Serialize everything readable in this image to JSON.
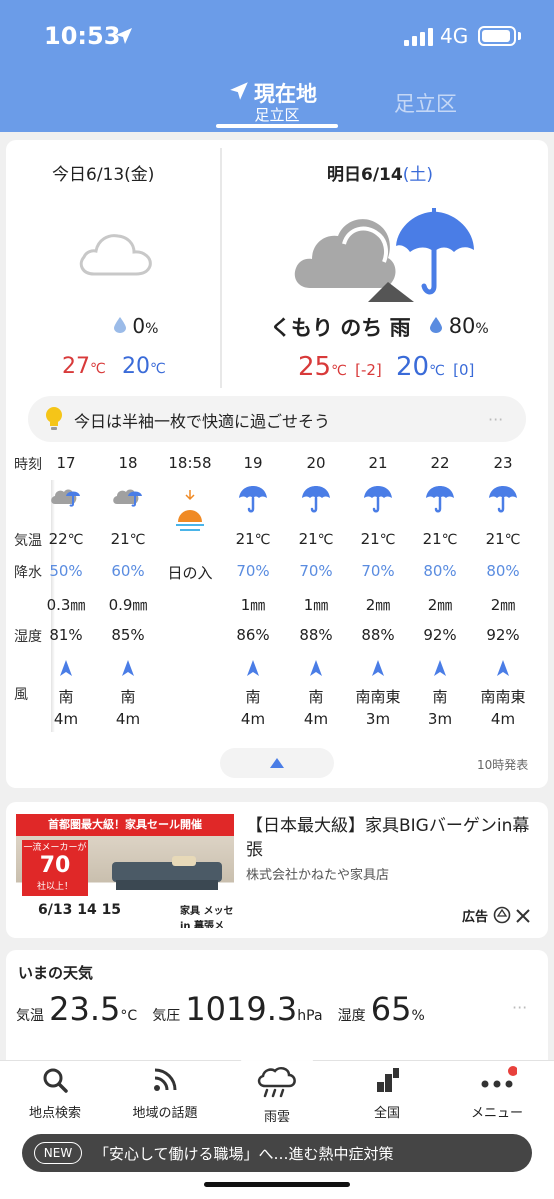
{
  "status": {
    "time": "10:53",
    "network": "4G"
  },
  "header": {
    "tabs": [
      {
        "title": "現在地",
        "subtitle": "足立区"
      },
      {
        "title": "足立区"
      }
    ]
  },
  "today": {
    "label": "今日6/13(金)",
    "precip": "0",
    "precip_unit": "%",
    "high": "27",
    "low": "20",
    "temp_unit": "℃",
    "icon": "cloud-icon"
  },
  "tomorrow": {
    "label": "明日6/14",
    "weekday": "(土)",
    "desc": "くもり のち 雨",
    "precip": "80",
    "precip_unit": "%",
    "high": "25",
    "high_diff": "[-2]",
    "low": "20",
    "low_diff": "[0]",
    "temp_unit": "℃",
    "icon": "cloud-then-rain-icon"
  },
  "tip": {
    "text": "今日は半袖一枚で快適に過ごせそう",
    "more": "···"
  },
  "hourly": {
    "row_labels": {
      "time": "時刻",
      "temp": "気温",
      "precip": "降水",
      "humidity": "湿度",
      "wind": "風"
    },
    "columns": [
      {
        "time": "17",
        "temp": "22",
        "precip": "50%",
        "amount": "0.3㎜",
        "humidity": "81%",
        "wind_dir": "南",
        "wind_speed": "4m",
        "icon": "cloudy-rain-icon"
      },
      {
        "time": "18",
        "temp": "21",
        "precip": "60%",
        "amount": "0.9㎜",
        "humidity": "85%",
        "wind_dir": "南",
        "wind_speed": "4m",
        "icon": "cloudy-rain-icon"
      },
      {
        "time": "18:58",
        "sunset_label": "日の入",
        "icon": "sunset-icon"
      },
      {
        "time": "19",
        "temp": "21",
        "precip": "70%",
        "amount": "1㎜",
        "humidity": "86%",
        "wind_dir": "南",
        "wind_speed": "4m",
        "icon": "umbrella-icon"
      },
      {
        "time": "20",
        "temp": "21",
        "precip": "70%",
        "amount": "1㎜",
        "humidity": "88%",
        "wind_dir": "南",
        "wind_speed": "4m",
        "icon": "umbrella-icon"
      },
      {
        "time": "21",
        "temp": "21",
        "precip": "70%",
        "amount": "2㎜",
        "humidity": "88%",
        "wind_dir": "南南東",
        "wind_speed": "3m",
        "icon": "umbrella-icon"
      },
      {
        "time": "22",
        "temp": "21",
        "precip": "80%",
        "amount": "2㎜",
        "humidity": "92%",
        "wind_dir": "南",
        "wind_speed": "3m",
        "icon": "umbrella-icon"
      },
      {
        "time": "23",
        "temp": "21",
        "precip": "80%",
        "amount": "2㎜",
        "humidity": "92%",
        "wind_dir": "南南東",
        "wind_speed": "4m",
        "icon": "umbrella-icon"
      }
    ],
    "issued": "10時発表"
  },
  "ad": {
    "banner": "首都圏最大級！家具セール開催",
    "badge_top": "一流メーカーが",
    "badge_num": "70",
    "badge_bottom": "社以上！",
    "dates": "6/13 14 15",
    "brand": "家具 メッセ in 幕張メッセ",
    "title": "【日本最大級】家具BIGバーゲンin幕張",
    "company": "株式会社かねたや家具店",
    "label": "広告"
  },
  "now": {
    "title": "いまの天気",
    "temp_label": "気温",
    "temp": "23.5",
    "temp_unit": "°C",
    "pressure_label": "気圧",
    "pressure": "1019.3",
    "pressure_unit": "hPa",
    "humidity_label": "湿度",
    "humidity": "65",
    "humidity_unit": "%"
  },
  "nav": {
    "items": [
      {
        "label": "地点検索",
        "icon": "search-icon"
      },
      {
        "label": "地域の話題",
        "icon": "rss-icon"
      },
      {
        "label": "雨雲",
        "icon": "rain-cloud-icon"
      },
      {
        "label": "全国",
        "icon": "bar-map-icon"
      },
      {
        "label": "メニュー",
        "icon": "more-dots-icon"
      }
    ]
  },
  "news": {
    "badge": "NEW",
    "text": "「安心して働ける職場」へ…進む熱中症対策"
  },
  "colors": {
    "header": "#6b9ce8",
    "high": "#d83a3a",
    "low": "#3a6bd8",
    "precip": "#5a8ce0",
    "umbrella": "#4a7de6"
  }
}
